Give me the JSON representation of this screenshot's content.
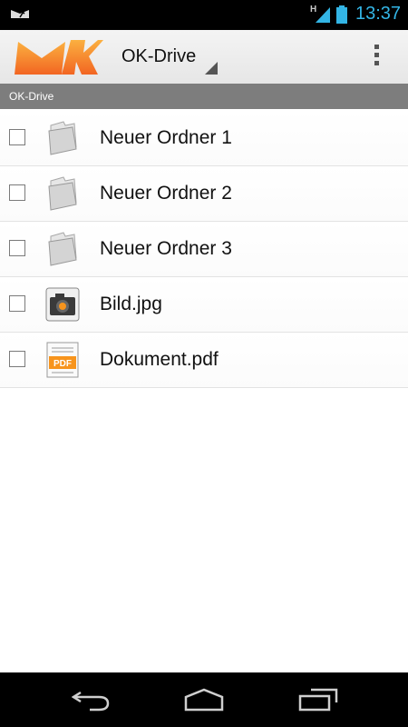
{
  "status_bar": {
    "time": "13:37",
    "network_type": "H",
    "colors": {
      "clock": "#33b5e5"
    },
    "icons": [
      "notification-logo-icon",
      "signal-icon",
      "battery-icon"
    ]
  },
  "action_bar": {
    "title": "OK-Drive",
    "logo_icon": "ok-mail-logo-icon",
    "menu_icon": "overflow-menu-icon",
    "colors": {
      "logo": "#f7941d"
    }
  },
  "breadcrumb": {
    "path": "OK-Drive"
  },
  "files": [
    {
      "name": "Neuer Ordner 1",
      "icon": "folder-icon",
      "checked": false
    },
    {
      "name": "Neuer Ordner 2",
      "icon": "folder-icon",
      "checked": false
    },
    {
      "name": "Neuer Ordner 3",
      "icon": "folder-icon",
      "checked": false
    },
    {
      "name": "Bild.jpg",
      "icon": "image-file-icon",
      "checked": false
    },
    {
      "name": "Dokument.pdf",
      "icon": "pdf-file-icon",
      "checked": false,
      "icon_label": "PDF"
    }
  ],
  "nav_bar": {
    "buttons": [
      "back-icon",
      "home-icon",
      "recent-apps-icon"
    ]
  }
}
